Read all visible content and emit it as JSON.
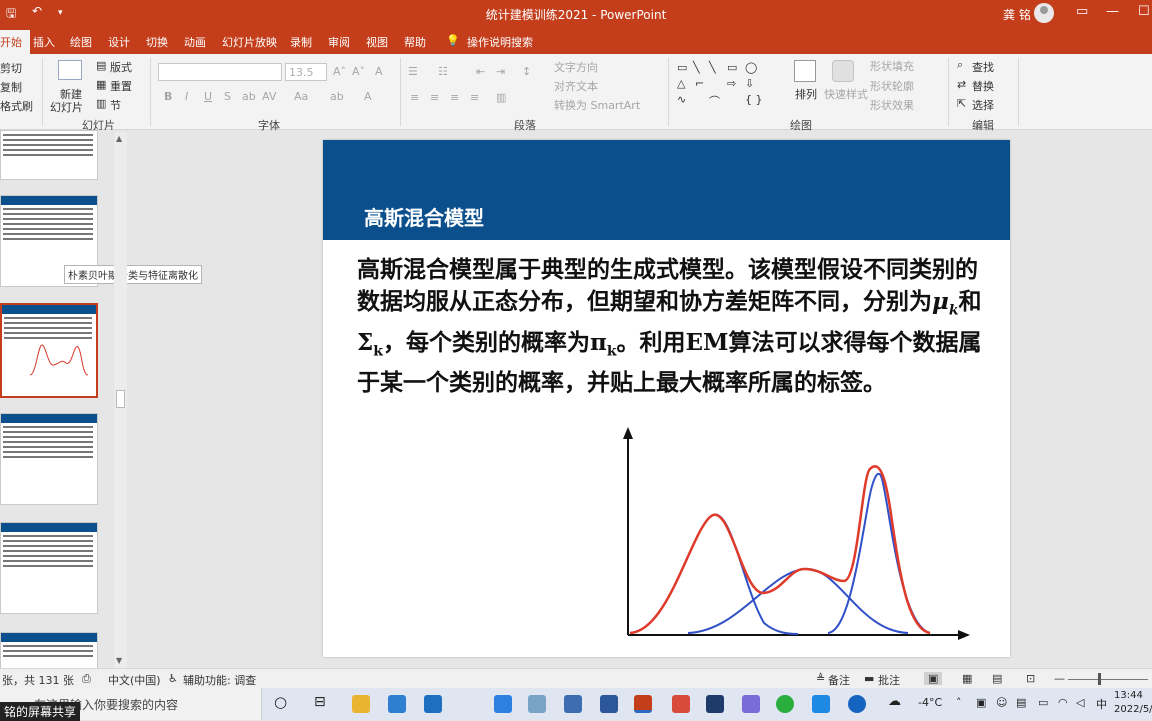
{
  "window": {
    "title": "统计建模训练2021 - PowerPoint",
    "user": "龚 铭",
    "controls": [
      "▭",
      "—",
      "☐",
      "✕"
    ]
  },
  "tabs": [
    "开始",
    "插入",
    "绘图",
    "设计",
    "切换",
    "动画",
    "幻灯片放映",
    "录制",
    "审阅",
    "视图",
    "帮助",
    "操作说明搜索"
  ],
  "ribbon": {
    "clipboard": {
      "cut": "剪切",
      "copy": "复制",
      "format": "格式刷"
    },
    "slides": {
      "new_slide_line1": "新建",
      "new_slide_line2": "幻灯片",
      "layout": "版式",
      "reset": "重置",
      "section": "节",
      "label": "幻灯片"
    },
    "font": {
      "size": "13.5",
      "label": "字体"
    },
    "paragraph": {
      "text_direction": "文字方向",
      "align_text": "对齐文本",
      "smartart": "转换为 SmartArt",
      "label": "段落"
    },
    "drawing": {
      "arrange": "排列",
      "quick_styles": "快速样式",
      "fill": "形状填充",
      "outline": "形状轮廓",
      "effects": "形状效果",
      "label": "绘图"
    },
    "editing": {
      "find": "查找",
      "replace": "替换",
      "select": "选择",
      "label": "编辑"
    }
  },
  "thumbnails": {
    "tooltip": "朴素贝叶斯分类与特征离散化"
  },
  "slide": {
    "heading": "高斯混合模型",
    "body_part1": "高斯混合模型属于典型的生成式模型。该模型假设不同类别的数据均服从正态分布，但期望和协方差矩阵不同，分别为",
    "mu": "μ",
    "mu_sub": "k",
    "and": "和",
    "sigma": "Σ",
    "sigma_sub": "k",
    "body_part2": "，每个类别的概率为",
    "pi": "π",
    "pi_sub": "k",
    "body_part3": "。利用EM算法可以求得每个数据属于某一个类别的概率，并贴上最大概率所属的标签。"
  },
  "statusbar": {
    "slide_count": "张，共 131 张",
    "language": "中文(中国)",
    "accessibility": "辅助功能: 调查",
    "notes": "备注",
    "comments": "批注"
  },
  "taskbar": {
    "search_placeholder": "在这里输入你要搜索的内容",
    "share_label": "铭的屏幕共享",
    "weather": "-4°C",
    "ime": "中",
    "time": "13:44",
    "date": "2022/5/"
  }
}
